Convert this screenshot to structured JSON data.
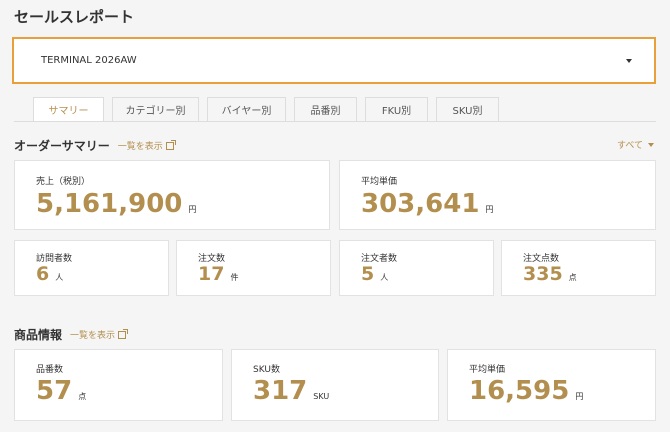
{
  "page": {
    "title": "セールスレポート"
  },
  "selector": {
    "value": "TERMINAL 2026AW"
  },
  "tabs": [
    {
      "label": "サマリー",
      "active": true
    },
    {
      "label": "カテゴリー別"
    },
    {
      "label": "バイヤー別"
    },
    {
      "label": "品番別"
    },
    {
      "label": "FKU別"
    },
    {
      "label": "SKU別"
    }
  ],
  "order_summary": {
    "title": "オーダーサマリー",
    "link": "一覧を表示",
    "filter": "すべて",
    "sales": {
      "label": "売上（税別）",
      "value": "5,161,900",
      "unit": "円"
    },
    "avg_price": {
      "label": "平均単価",
      "value": "303,641",
      "unit": "円"
    },
    "visitors": {
      "label": "訪問者数",
      "value": "6",
      "unit": "人"
    },
    "orders": {
      "label": "注文数",
      "value": "17",
      "unit": "件"
    },
    "orderers": {
      "label": "注文者数",
      "value": "5",
      "unit": "人"
    },
    "order_items": {
      "label": "注文点数",
      "value": "335",
      "unit": "点"
    }
  },
  "product_info": {
    "title": "商品情報",
    "link": "一覧を表示",
    "item_count": {
      "label": "品番数",
      "value": "57",
      "unit": "点"
    },
    "sku_count": {
      "label": "SKU数",
      "value": "317",
      "unit": "SKU"
    },
    "avg_price": {
      "label": "平均単価",
      "value": "16,595",
      "unit": "円"
    }
  },
  "colors": {
    "accent": "#b38f4f",
    "focus_border": "#e8a13a"
  }
}
